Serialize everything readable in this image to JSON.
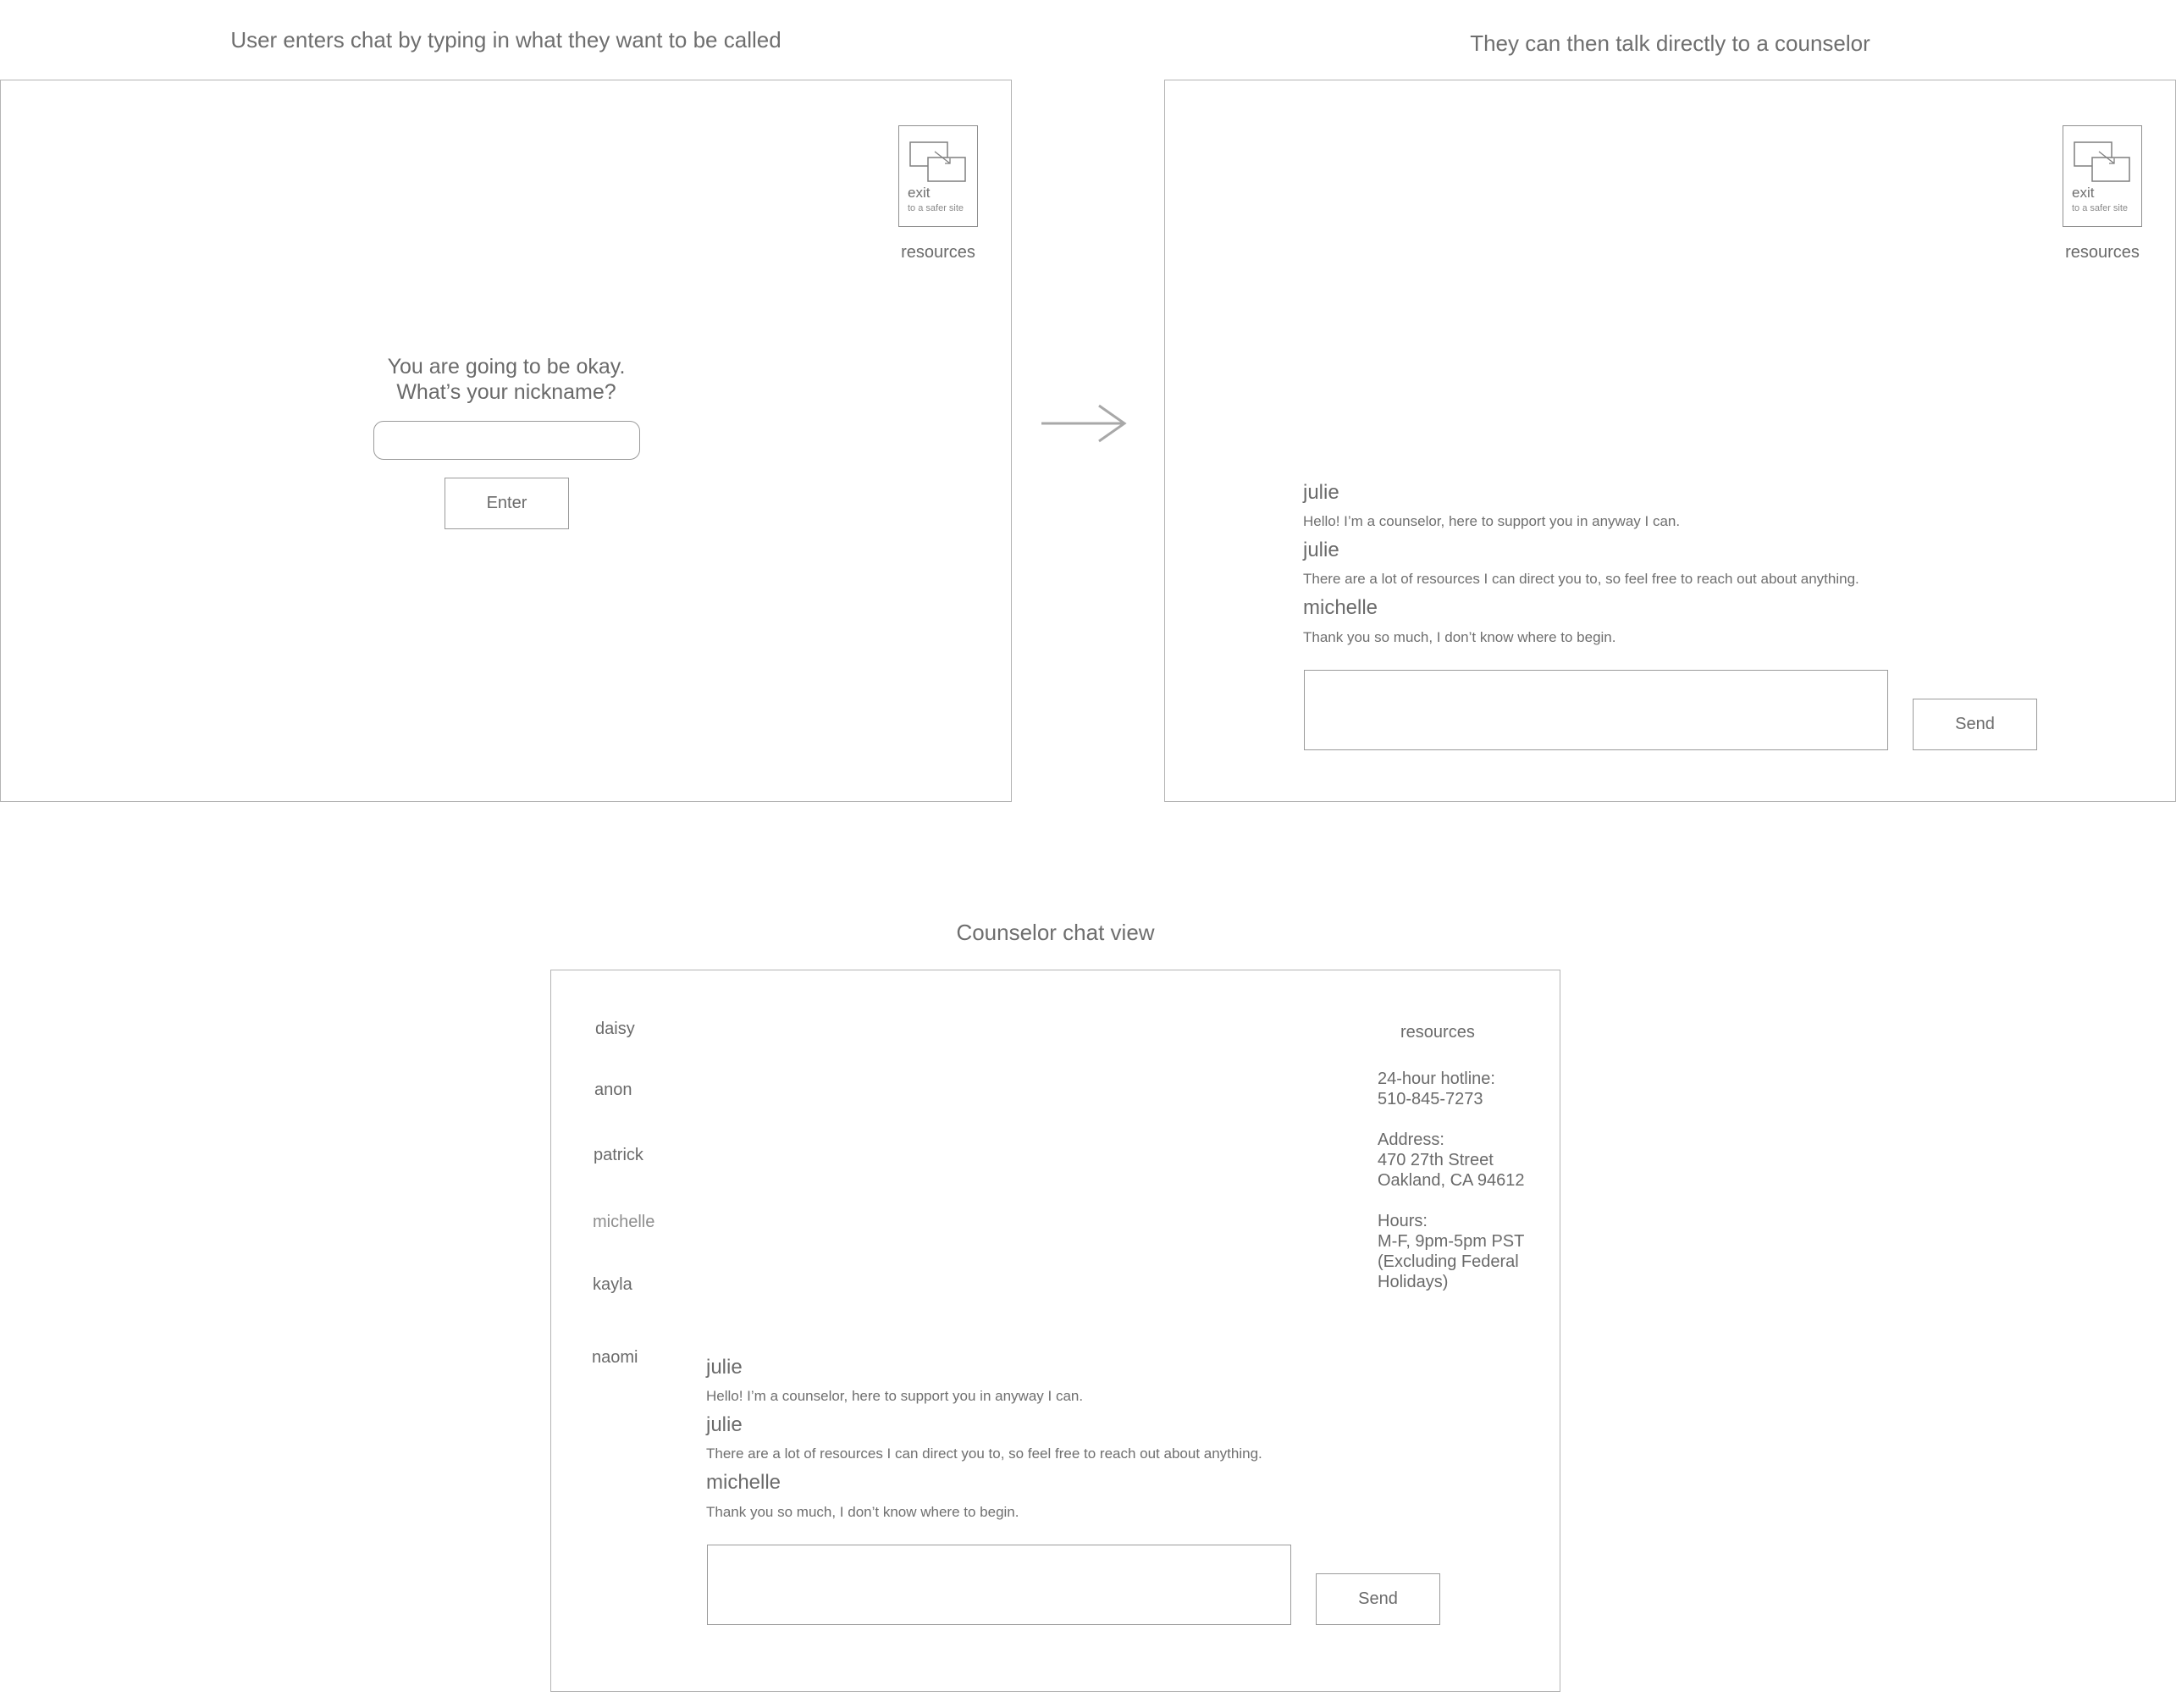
{
  "captions": {
    "entry": "User enters chat by typing in what they want to be called",
    "chat": "They can then talk directly to a counselor",
    "counselor": "Counselor chat view"
  },
  "exit_button": {
    "label": "exit",
    "sublabel": "to a safer site"
  },
  "resources_link": "resources",
  "entry_screen": {
    "prompt_line1": "You are going to be okay.",
    "prompt_line2": "What’s your nickname?",
    "nickname_value": "",
    "enter_label": "Enter"
  },
  "messages": [
    {
      "sender": "julie",
      "text": "Hello! I’m a counselor, here to support you in anyway I can."
    },
    {
      "sender": "julie",
      "text": "There are a lot of resources I can direct you to, so feel free to reach out about anything."
    },
    {
      "sender": "michelle",
      "text": "Thank you so much, I don’t know where to begin."
    }
  ],
  "send_label": "Send",
  "message_input_value": "",
  "counselor_view": {
    "users": [
      "daisy",
      "anon",
      "patrick",
      "michelle",
      "kayla",
      "naomi"
    ],
    "resources_title": "resources",
    "hotline_label": "24-hour hotline:",
    "hotline_number": "510-845-7273",
    "address_label": "Address:",
    "address_line1": "470 27th Street",
    "address_line2": "Oakland, CA 94612",
    "hours_label": "Hours:",
    "hours_line1": "M-F, 9pm-5pm PST",
    "hours_line2": "(Excluding Federal",
    "hours_line3": "Holidays)"
  },
  "colors": {
    "border": "#b4b4b4",
    "text": "#6b6b6b",
    "arrow": "#a8a8a8"
  }
}
